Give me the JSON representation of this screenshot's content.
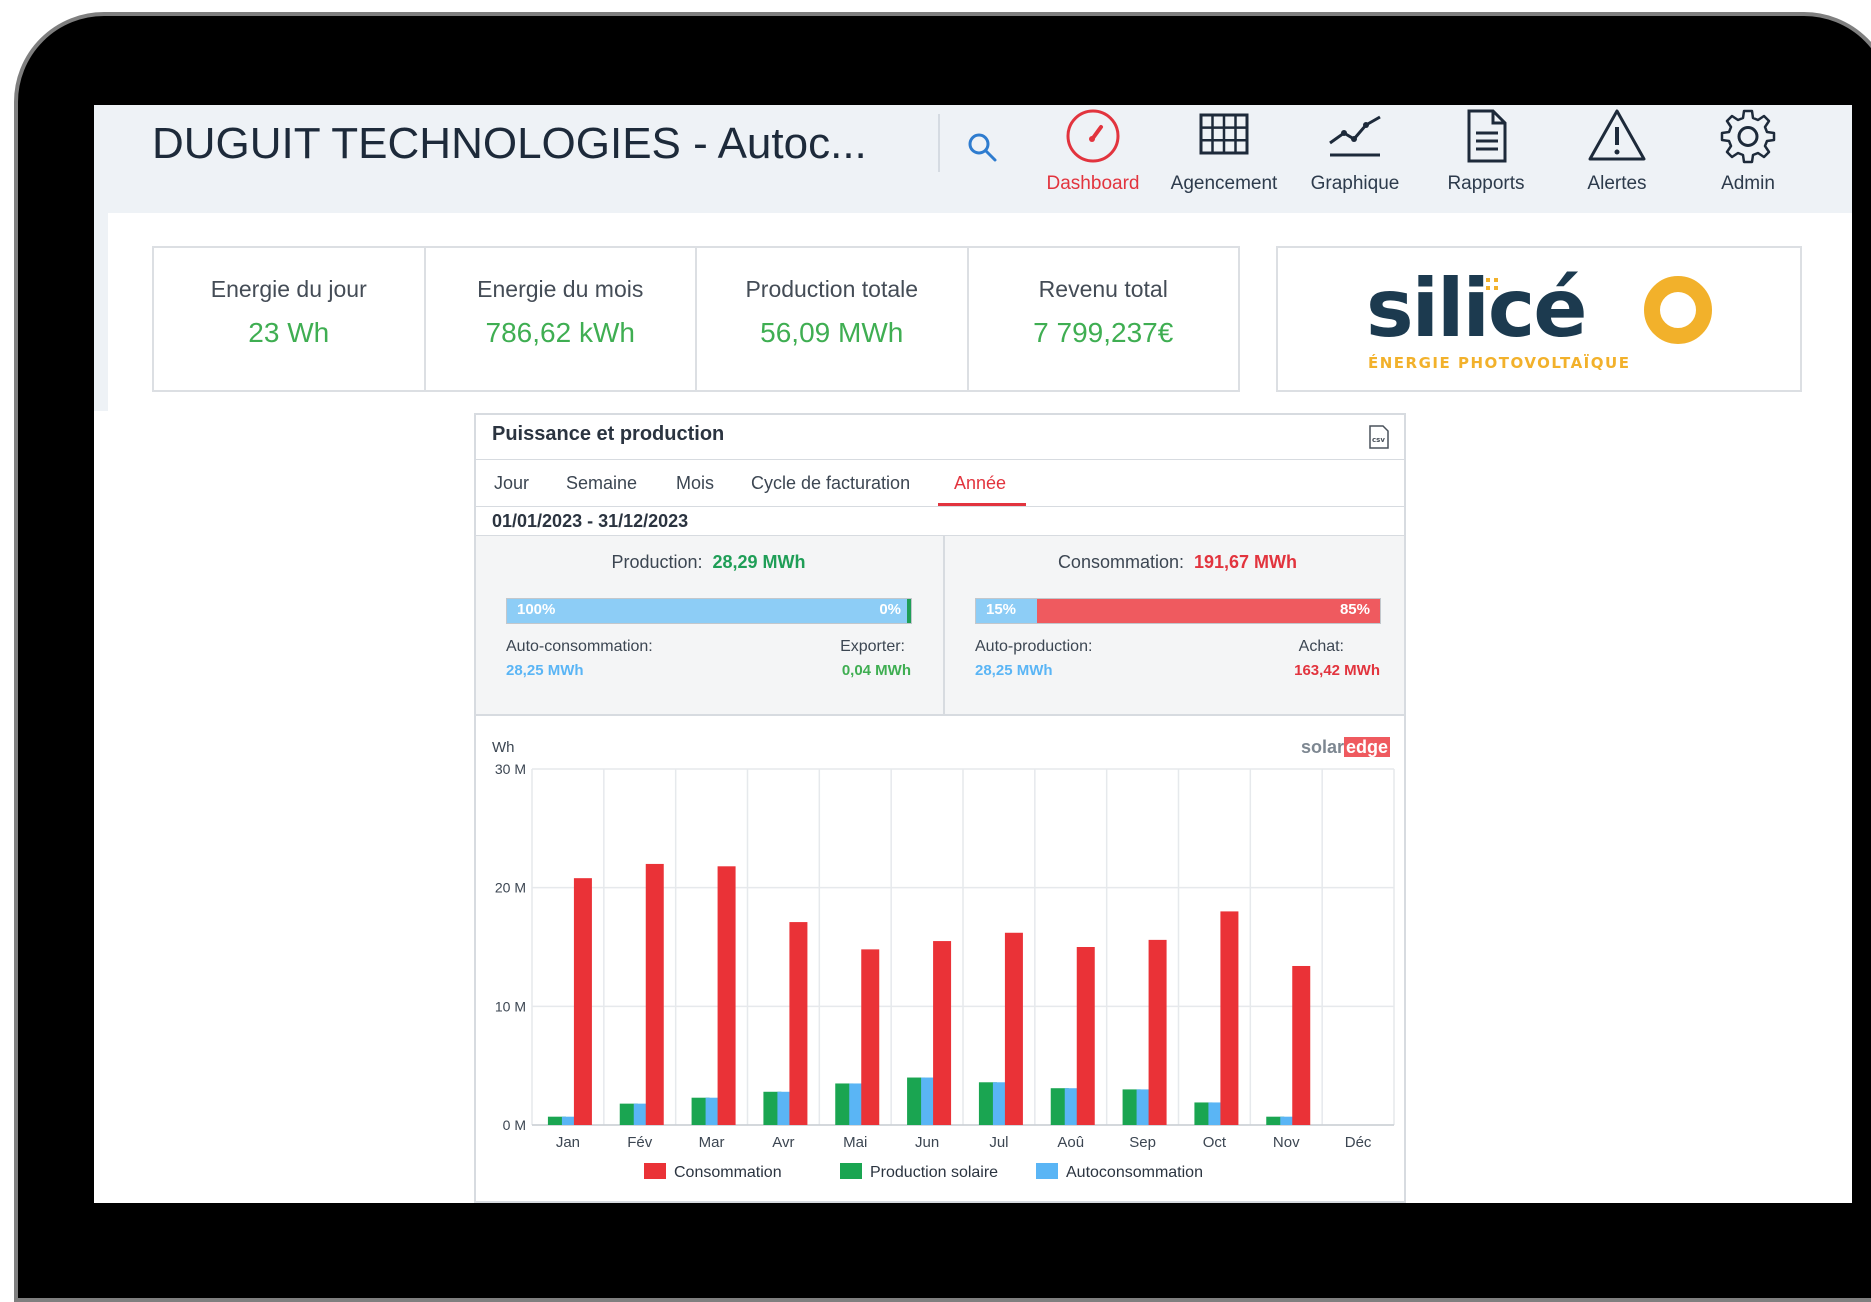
{
  "header": {
    "title": "DUGUIT TECHNOLOGIES - Autoc...",
    "nav": [
      {
        "label": "Dashboard",
        "icon": "dashboard-gauge-icon",
        "active": true
      },
      {
        "label": "Agencement",
        "icon": "grid-layout-icon",
        "active": false
      },
      {
        "label": "Graphique",
        "icon": "line-graph-icon",
        "active": false
      },
      {
        "label": "Rapports",
        "icon": "document-icon",
        "active": false
      },
      {
        "label": "Alertes",
        "icon": "warning-icon",
        "active": false
      },
      {
        "label": "Admin",
        "icon": "gear-icon",
        "active": false
      }
    ]
  },
  "kpis": [
    {
      "label": "Energie du jour",
      "value": "23 Wh"
    },
    {
      "label": "Energie du mois",
      "value": "786,62 kWh"
    },
    {
      "label": "Production totale",
      "value": "56,09 MWh"
    },
    {
      "label": "Revenu total",
      "value": "7 799,237€"
    }
  ],
  "logo": {
    "name": "silicéO",
    "tagline": "ÉNERGIE PHOTOVOLTAÏQUE",
    "colors": {
      "dark": "#1c3a4f",
      "accent": "#f2b12b"
    }
  },
  "widget": {
    "title": "Puissance et production",
    "tabs": [
      "Jour",
      "Semaine",
      "Mois",
      "Cycle de facturation",
      "Année"
    ],
    "active_tab": "Année",
    "date_range": "01/01/2023 - 31/12/2023",
    "production": {
      "label": "Production:",
      "value": "28,29 MWh",
      "bar_left": "100%",
      "bar_right": "0%",
      "self_fraction": 1.0,
      "left_label": "Auto-consommation:",
      "left_value": "28,25 MWh",
      "right_label": "Exporter:",
      "right_value": "0,04 MWh"
    },
    "consumption": {
      "label": "Consommation:",
      "value": "191,67 MWh",
      "bar_left": "15%",
      "bar_right": "85%",
      "self_fraction": 0.15,
      "left_label": "Auto-production:",
      "left_value": "28,25 MWh",
      "right_label": "Achat:",
      "right_value": "163,42 MWh"
    },
    "brand_left": "solar",
    "brand_right": "edge"
  },
  "colors": {
    "consumption": "#ea3237",
    "production": "#1aa551",
    "selfconsumption": "#5ab5f5",
    "positive": "#3fae52",
    "accent": "#e2343e"
  },
  "chart_data": {
    "type": "bar",
    "unit_label": "Wh",
    "categories": [
      "Jan",
      "Fév",
      "Mar",
      "Avr",
      "Mai",
      "Jun",
      "Jul",
      "Aoû",
      "Sep",
      "Oct",
      "Nov",
      "Déc"
    ],
    "y_ticks": [
      "0 M",
      "10 M",
      "20 M",
      "30 M"
    ],
    "ylim": [
      0,
      30000000
    ],
    "series": [
      {
        "name": "Consommation",
        "color": "#ea3237",
        "values": [
          20800000,
          22000000,
          21800000,
          17100000,
          14800000,
          15500000,
          16200000,
          15000000,
          15600000,
          18000000,
          13400000,
          0
        ]
      },
      {
        "name": "Production solaire",
        "color": "#1aa551",
        "values": [
          700000,
          1800000,
          2300000,
          2800000,
          3500000,
          4000000,
          3600000,
          3100000,
          3000000,
          1900000,
          700000,
          0
        ]
      },
      {
        "name": "Autoconsommation",
        "color": "#5ab5f5",
        "values": [
          700000,
          1800000,
          2300000,
          2800000,
          3500000,
          4000000,
          3600000,
          3100000,
          3000000,
          1900000,
          700000,
          0
        ]
      }
    ],
    "grid": true,
    "legend": "bottom"
  }
}
